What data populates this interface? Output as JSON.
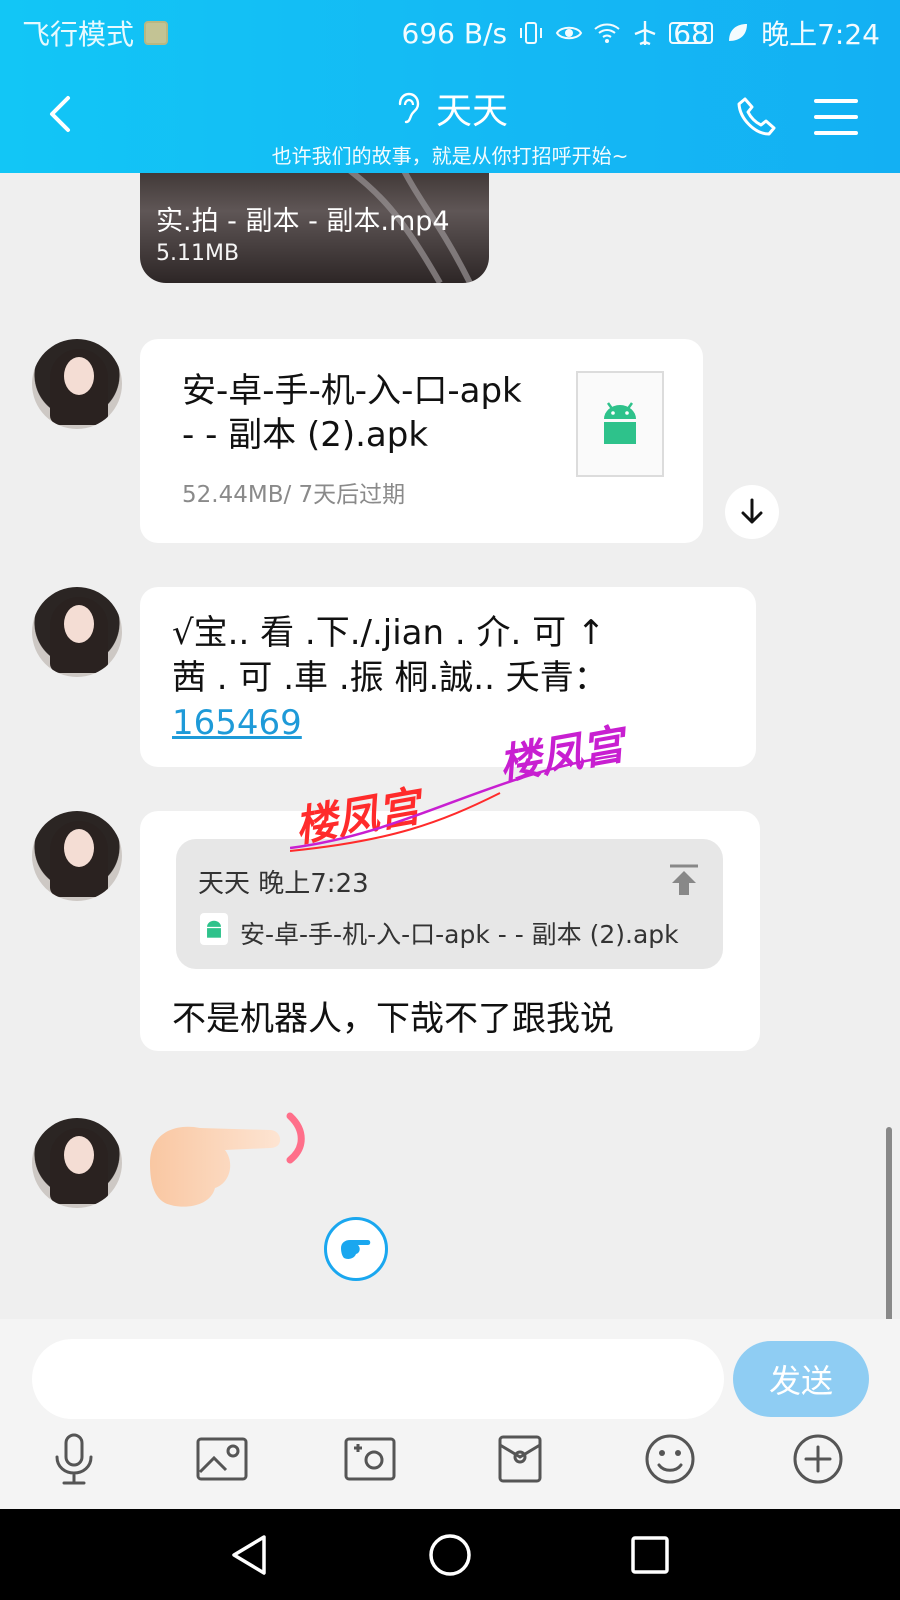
{
  "status_bar": {
    "left_text": "飞行模式",
    "network_speed": "696 B/s",
    "battery_level": "68",
    "time": "晚上7:24"
  },
  "header": {
    "title": "天天",
    "subtitle": "也许我们的故事，就是从你打招呼开始~"
  },
  "messages": {
    "video": {
      "filename": "实.拍 - 副本 - 副本.mp4",
      "size": "5.11MB"
    },
    "apk_file": {
      "filename_line1": "安-卓-手-机-入-口-apk",
      "filename_line2": "- - 副本 (2).apk",
      "meta": "52.44MB/ 7天后过期"
    },
    "text": {
      "line1": "√宝.. 看 .下./.jian .  介. 可   ↑",
      "line2": "茜 . 可  .車 .振    桐.誠..   夭青：",
      "link": "165469"
    },
    "reply": {
      "quote_name_time": "天天 晚上7:23",
      "quote_file": "安-卓-手-机-入-口-apk - - 副本 (2).apk",
      "text": "不是机器人，下哉不了跟我说"
    },
    "watermark": "楼凤宫"
  },
  "input": {
    "placeholder": "",
    "send_label": "发送"
  },
  "colors": {
    "header": "#14b9f4",
    "send_button": "#8fcdf3",
    "link": "#1e9ad8",
    "android_green": "#2ec28b"
  }
}
